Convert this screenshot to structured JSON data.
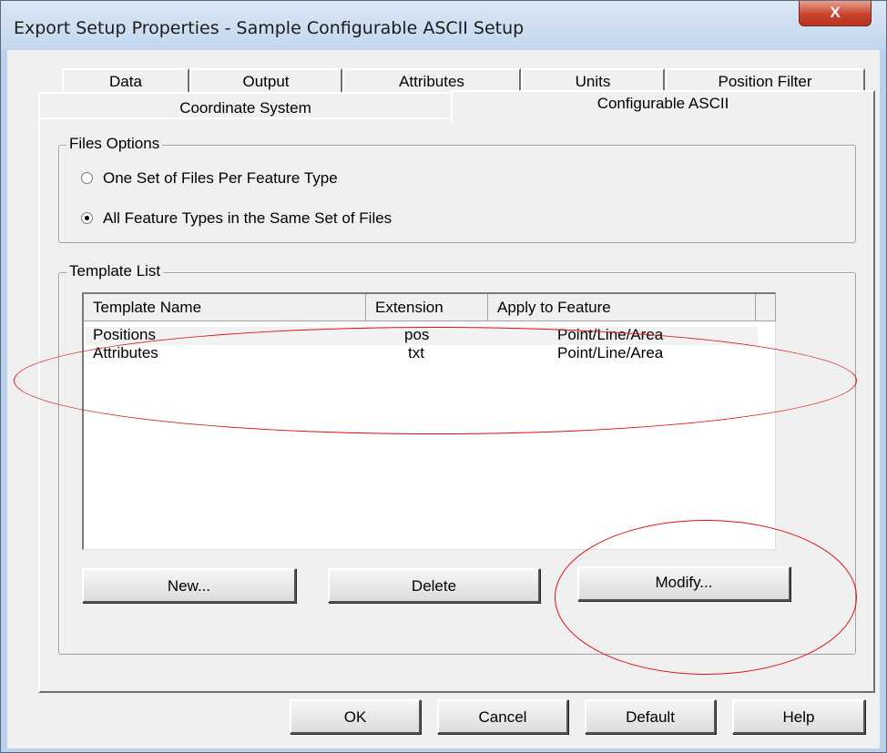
{
  "window": {
    "title": "Export Setup Properties - Sample Configurable ASCII Setup",
    "close_glyph": "X"
  },
  "tabs": {
    "row1": [
      "Data",
      "Output",
      "Attributes",
      "Units",
      "Position Filter"
    ],
    "row2": [
      "Coordinate System",
      "Configurable ASCII"
    ],
    "selected": "Configurable ASCII"
  },
  "files_options": {
    "label": "Files Options",
    "options": [
      {
        "label": "One Set of Files Per Feature Type",
        "selected": false
      },
      {
        "label": "All Feature Types in the Same Set of Files",
        "selected": true
      }
    ]
  },
  "template_list": {
    "label": "Template List",
    "columns": [
      "Template Name",
      "Extension",
      "Apply to Feature"
    ],
    "rows": [
      {
        "name": "Positions",
        "extension": "pos",
        "apply": "Point/Line/Area"
      },
      {
        "name": "Attributes",
        "extension": "txt",
        "apply": "Point/Line/Area"
      }
    ],
    "buttons": [
      "New...",
      "Delete",
      "Modify..."
    ]
  },
  "footer_buttons": [
    "OK",
    "Cancel",
    "Default",
    "Help"
  ],
  "colors": {
    "annotation": "#e01010",
    "title_bar": "#c2d7ee",
    "close_button": "#c7432c",
    "dialog_face": "#f0f0f0"
  }
}
